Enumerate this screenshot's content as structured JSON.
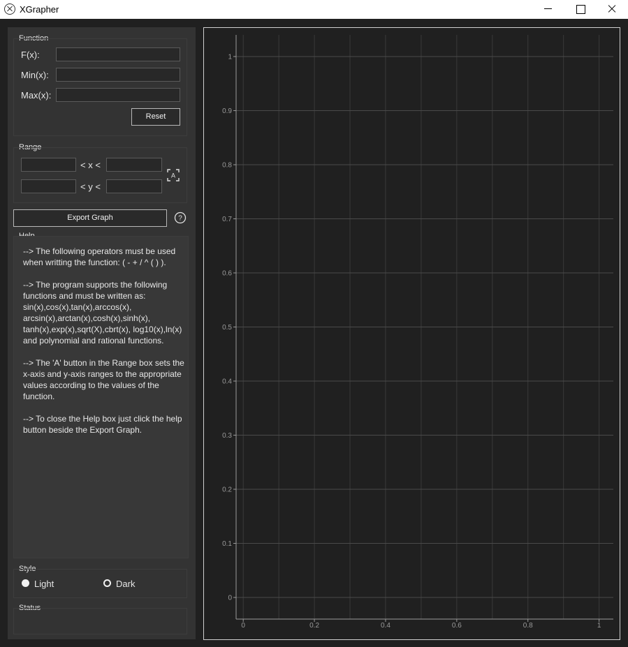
{
  "window": {
    "title": "XGrapher",
    "app_icon": "xgrapher-logo-icon",
    "minimize_icon": "minimize-icon",
    "maximize_icon": "maximize-icon",
    "close_icon": "close-icon"
  },
  "function_group": {
    "title": "Function",
    "fx_label": "F(x):",
    "min_label": "Min(x):",
    "max_label": "Max(x):",
    "fx_value": "",
    "min_value": "",
    "max_value": "",
    "reset_label": "Reset"
  },
  "range_group": {
    "title": "Range",
    "x_label": "< x <",
    "y_label": "< y <",
    "x_min": "",
    "x_max": "",
    "y_min": "",
    "y_max": "",
    "auto_icon": "auto-range-icon"
  },
  "export_label": "Export Graph",
  "help_icon": "help-icon",
  "help_group": {
    "title": "Help",
    "paragraphs": [
      "--> The following operators must be used when writting the function: ( - + / ^ ( ) ).",
      "--> The program supports the following functions and must be written as: sin(x),cos(x),tan(x),arccos(x), arcsin(x),arctan(x),cosh(x),sinh(x), tanh(x),exp(x),sqrt(X),cbrt(x), log10(x),ln(x) and polynomial and rational functions.",
      "--> The 'A' button in the Range box sets the x-axis and y-axis ranges to the appropriate values according to the values of the function.",
      "--> To close the Help box just click the help button beside the Export Graph."
    ]
  },
  "style_group": {
    "title": "Style",
    "options": [
      "Light",
      "Dark"
    ],
    "selected": "Light"
  },
  "status_group": {
    "title": "Status",
    "text": ""
  },
  "chart_data": {
    "type": "line",
    "title": "",
    "xlabel": "",
    "ylabel": "",
    "xlim": [
      -0.02,
      1.04
    ],
    "ylim": [
      -0.04,
      1.04
    ],
    "x_ticks": [
      "0",
      "0.2",
      "0.4",
      "0.6",
      "0.8",
      "1"
    ],
    "y_ticks": [
      "0",
      "0.1",
      "0.2",
      "0.3",
      "0.4",
      "0.5",
      "0.6",
      "0.7",
      "0.8",
      "0.9",
      "1"
    ],
    "grid": true,
    "series": []
  },
  "colors": {
    "background": "#202020",
    "panel": "#333333",
    "grid": "#3a3a3a",
    "axis": "#9a9a9a"
  }
}
